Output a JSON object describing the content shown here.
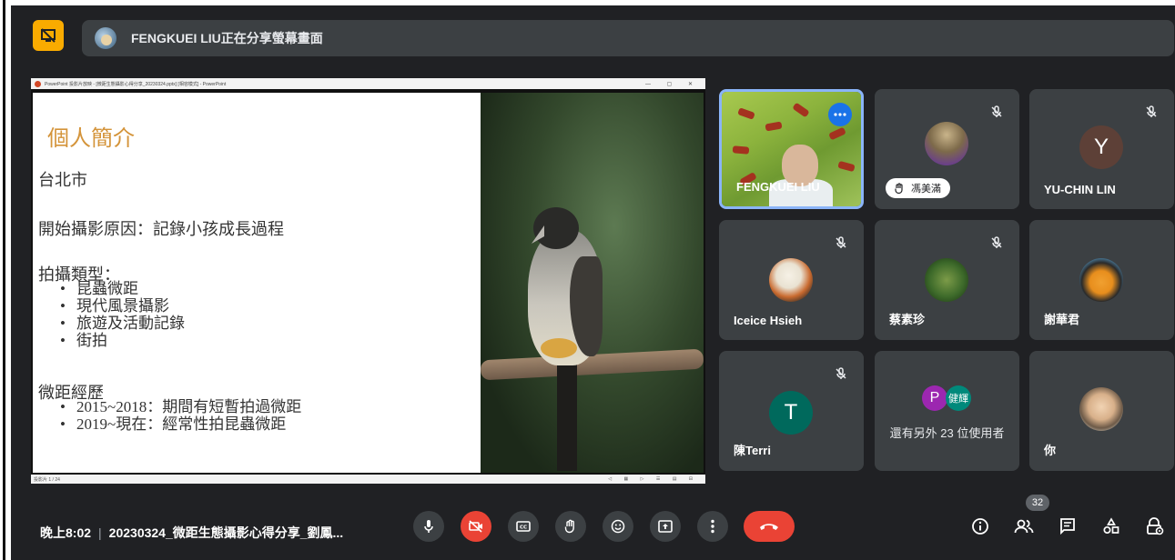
{
  "banner": {
    "presenter_text": "FENGKUEI LIU正在分享螢幕畫面"
  },
  "ppt": {
    "window_title": "PowerPoint 投影片放映 - [微距生態攝影心得分享_20230324.pptx] [相容模式] - PowerPoint",
    "status_left": "投影片 1 / 24",
    "slide": {
      "title": "個人簡介",
      "city": "台北市",
      "reason": "開始攝影原因：記錄小孩成長過程",
      "types_heading": "拍攝類型：",
      "types": [
        "昆蟲微距",
        "現代風景攝影",
        "旅遊及活動記錄",
        "街拍"
      ],
      "exp_heading": "微距經歷",
      "exp": [
        "2015~2018：期間有短暫拍過微距",
        "2019~現在：經常性拍昆蟲微距"
      ]
    }
  },
  "participants": [
    {
      "name": "FENGKUEI LIU"
    },
    {
      "name": "馮美滿"
    },
    {
      "name": "YU-CHIN LIN",
      "initial": "Y",
      "color": "#5d4037"
    },
    {
      "name": "Iceice Hsieh"
    },
    {
      "name": "蔡素珍"
    },
    {
      "name": "謝華君"
    },
    {
      "name": "陳Terri",
      "initial": "T",
      "color": "#00695c"
    },
    {
      "name": "你"
    }
  ],
  "others_tile": {
    "label": "還有另外 23 位使用者",
    "avatar1_initial": "P",
    "avatar1_color": "#9c27b0",
    "avatar2_initial": "健輝",
    "avatar2_color": "#00897b"
  },
  "bottom_bar": {
    "time": "晚上8:02",
    "meeting_title": "20230324_微距生態攝影心得分享_劉鳳...",
    "participant_count": "32"
  },
  "colors": {
    "background": "#202124",
    "tile": "#3c4043",
    "hangup": "#ea4335",
    "present_accent": "#f9ab00"
  },
  "icons": [
    "present-stop-icon",
    "mic-icon",
    "camera-off-icon",
    "captions-icon",
    "raise-hand-icon",
    "emoji-icon",
    "present-screen-icon",
    "more-vert-icon",
    "call-end-icon",
    "info-icon",
    "people-icon",
    "chat-icon",
    "activities-icon",
    "host-controls-icon"
  ]
}
